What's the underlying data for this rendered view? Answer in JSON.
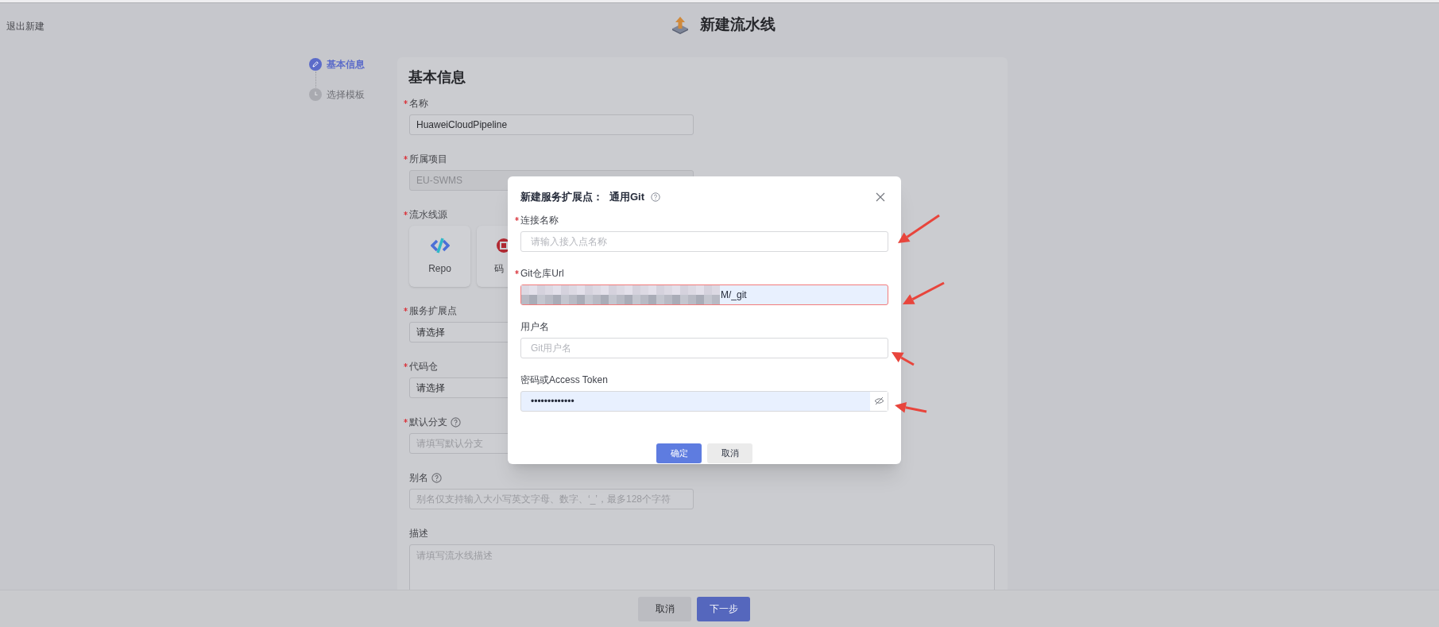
{
  "header": {
    "exit": "退出新建",
    "title": "新建流水线"
  },
  "steps": [
    {
      "label": "基本信息",
      "selected": true
    },
    {
      "label": "选择模板",
      "selected": false
    }
  ],
  "form": {
    "title": "基本信息",
    "fields": [
      {
        "kind": "input",
        "label": "名称",
        "required": true,
        "value": "HuaweiCloudPipeline"
      },
      {
        "kind": "input",
        "label": "所属项目",
        "required": true,
        "value": "EU-SWMS",
        "disabled": true
      },
      {
        "kind": "sources",
        "label": "流水线源",
        "required": true,
        "options": [
          {
            "label": "Repo"
          },
          {
            "label": "码"
          }
        ]
      },
      {
        "kind": "select",
        "label": "服务扩展点",
        "required": true,
        "value": "请选择"
      },
      {
        "kind": "select",
        "label": "代码仓",
        "required": true,
        "value": "请选择"
      },
      {
        "kind": "input",
        "label": "默认分支",
        "required": true,
        "help": true,
        "placeholder": "请填写默认分支"
      },
      {
        "kind": "input",
        "label": "别名",
        "required": false,
        "help": true,
        "placeholder": "别名仅支持输入大小写英文字母、数字、‘_’，最多128个字符"
      },
      {
        "kind": "textarea",
        "label": "描述",
        "required": false,
        "placeholder": "请填写流水线描述"
      }
    ]
  },
  "dialog": {
    "title": "新建服务扩展点：",
    "subtitle": "通用Git",
    "fields": [
      {
        "kind": "text",
        "label": "连接名称",
        "required": true,
        "placeholder": "请输入接入点名称",
        "arrow": true
      },
      {
        "kind": "text",
        "label": "Git仓库Url",
        "required": true,
        "value": "M/_git",
        "error": true,
        "redacted": true,
        "arrow": true
      },
      {
        "kind": "text",
        "label": "用户名",
        "required": false,
        "placeholder": "Git用户名",
        "arrow": true
      },
      {
        "kind": "password",
        "label": "密码或Access Token",
        "required": false,
        "value": "•••••••••••••",
        "arrow": true
      }
    ],
    "buttons": [
      {
        "label": "确定",
        "primary": true
      },
      {
        "label": "取消",
        "primary": false
      }
    ]
  },
  "footer": {
    "buttons": [
      {
        "label": "取消",
        "primary": false
      },
      {
        "label": "下一步",
        "primary": true
      }
    ]
  }
}
